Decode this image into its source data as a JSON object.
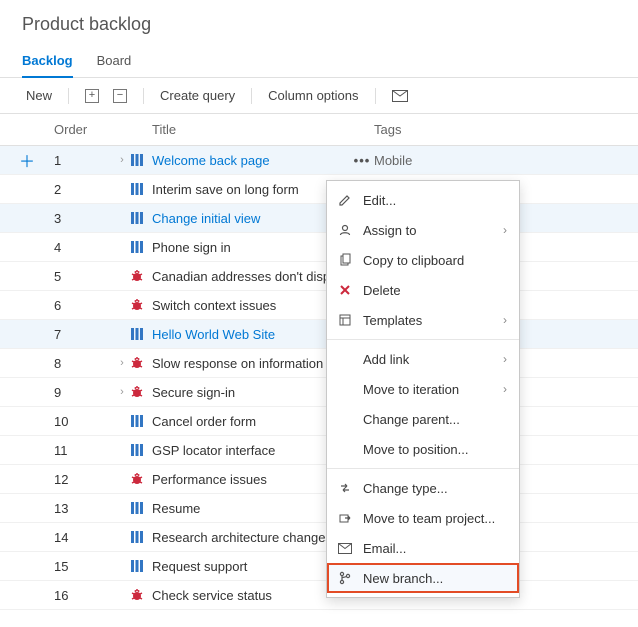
{
  "header": {
    "title": "Product backlog"
  },
  "tabs": [
    {
      "id": "backlog",
      "label": "Backlog",
      "active": true
    },
    {
      "id": "board",
      "label": "Board",
      "active": false
    }
  ],
  "toolbar": {
    "new_label": "New",
    "create_query_label": "Create query",
    "column_options_label": "Column options"
  },
  "columns": {
    "order": "Order",
    "title": "Title",
    "tags": "Tags"
  },
  "rows": [
    {
      "order": 1,
      "type": "pbi",
      "title": "Welcome back page",
      "link": true,
      "selected": true,
      "expandable": true,
      "tags": "Mobile",
      "showMenu": true
    },
    {
      "order": 2,
      "type": "pbi",
      "title": "Interim save on long form",
      "link": false,
      "selected": false,
      "expandable": false,
      "tags": ""
    },
    {
      "order": 3,
      "type": "pbi",
      "title": "Change initial view",
      "link": true,
      "selected": true,
      "expandable": false,
      "tags": ""
    },
    {
      "order": 4,
      "type": "pbi",
      "title": "Phone sign in",
      "link": false,
      "selected": false,
      "expandable": false,
      "tags": ""
    },
    {
      "order": 5,
      "type": "bug",
      "title": "Canadian addresses don't disp",
      "link": false,
      "selected": false,
      "expandable": false,
      "tags": ""
    },
    {
      "order": 6,
      "type": "bug",
      "title": "Switch context issues",
      "link": false,
      "selected": false,
      "expandable": false,
      "tags": ""
    },
    {
      "order": 7,
      "type": "pbi",
      "title": "Hello World Web Site",
      "link": true,
      "selected": true,
      "expandable": false,
      "tags": ""
    },
    {
      "order": 8,
      "type": "bug",
      "title": "Slow response on information",
      "link": false,
      "selected": false,
      "expandable": true,
      "tags": ""
    },
    {
      "order": 9,
      "type": "bug",
      "title": "Secure sign-in",
      "link": false,
      "selected": false,
      "expandable": true,
      "tags": ""
    },
    {
      "order": 10,
      "type": "pbi",
      "title": "Cancel order form",
      "link": false,
      "selected": false,
      "expandable": false,
      "tags": ""
    },
    {
      "order": 11,
      "type": "pbi",
      "title": "GSP locator interface",
      "link": false,
      "selected": false,
      "expandable": false,
      "tags": ""
    },
    {
      "order": 12,
      "type": "bug",
      "title": "Performance issues",
      "link": false,
      "selected": false,
      "expandable": false,
      "tags": ""
    },
    {
      "order": 13,
      "type": "pbi",
      "title": "Resume",
      "link": false,
      "selected": false,
      "expandable": false,
      "tags": ""
    },
    {
      "order": 14,
      "type": "pbi",
      "title": "Research architecture changes",
      "link": false,
      "selected": false,
      "expandable": false,
      "tags": ""
    },
    {
      "order": 15,
      "type": "pbi",
      "title": "Request support",
      "link": false,
      "selected": false,
      "expandable": false,
      "tags": ""
    },
    {
      "order": 16,
      "type": "bug",
      "title": "Check service status",
      "link": false,
      "selected": false,
      "expandable": false,
      "tags": ""
    }
  ],
  "context_menu": [
    {
      "icon": "edit-icon",
      "label": "Edit...",
      "submenu": false
    },
    {
      "icon": "assign-icon",
      "label": "Assign to",
      "submenu": true
    },
    {
      "icon": "copy-icon",
      "label": "Copy to clipboard",
      "submenu": false
    },
    {
      "icon": "delete-icon",
      "label": "Delete",
      "submenu": false,
      "danger": true
    },
    {
      "icon": "templates-icon",
      "label": "Templates",
      "submenu": true
    },
    {
      "divider": true
    },
    {
      "icon": "",
      "label": "Add link",
      "submenu": true
    },
    {
      "icon": "",
      "label": "Move to iteration",
      "submenu": true
    },
    {
      "icon": "",
      "label": "Change parent...",
      "submenu": false
    },
    {
      "icon": "",
      "label": "Move to position...",
      "submenu": false
    },
    {
      "divider": true
    },
    {
      "icon": "change-type-icon",
      "label": "Change type...",
      "submenu": false
    },
    {
      "icon": "move-proj-icon",
      "label": "Move to team project...",
      "submenu": false
    },
    {
      "icon": "email-icon",
      "label": "Email...",
      "submenu": false
    },
    {
      "icon": "branch-icon",
      "label": "New branch...",
      "submenu": false,
      "highlight": true
    }
  ]
}
